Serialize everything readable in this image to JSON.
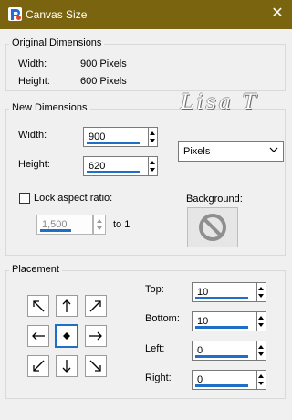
{
  "window": {
    "title": "Canvas Size",
    "close_glyph": "✕"
  },
  "original": {
    "group_label": "Original Dimensions",
    "width_label": "Width:",
    "width_value": "900 Pixels",
    "height_label": "Height:",
    "height_value": "600 Pixels"
  },
  "new_dims": {
    "group_label": "New Dimensions",
    "width_label": "Width:",
    "width_value": "900",
    "height_label": "Height:",
    "height_value": "620",
    "units": "Pixels",
    "lock_label": "Lock aspect ratio:",
    "lock_checked": false,
    "ratio_value": "1,500",
    "ratio_suffix": "to 1",
    "background_label": "Background:",
    "watermark": "Lisa T"
  },
  "placement": {
    "group_label": "Placement",
    "top_label": "Top:",
    "top_value": "10",
    "bottom_label": "Bottom:",
    "bottom_value": "10",
    "left_label": "Left:",
    "left_value": "0",
    "right_label": "Right:",
    "right_value": "0",
    "selected_anchor": "center"
  },
  "colors": {
    "titlebar": "#7a6410",
    "accent": "#1f6fc8"
  }
}
